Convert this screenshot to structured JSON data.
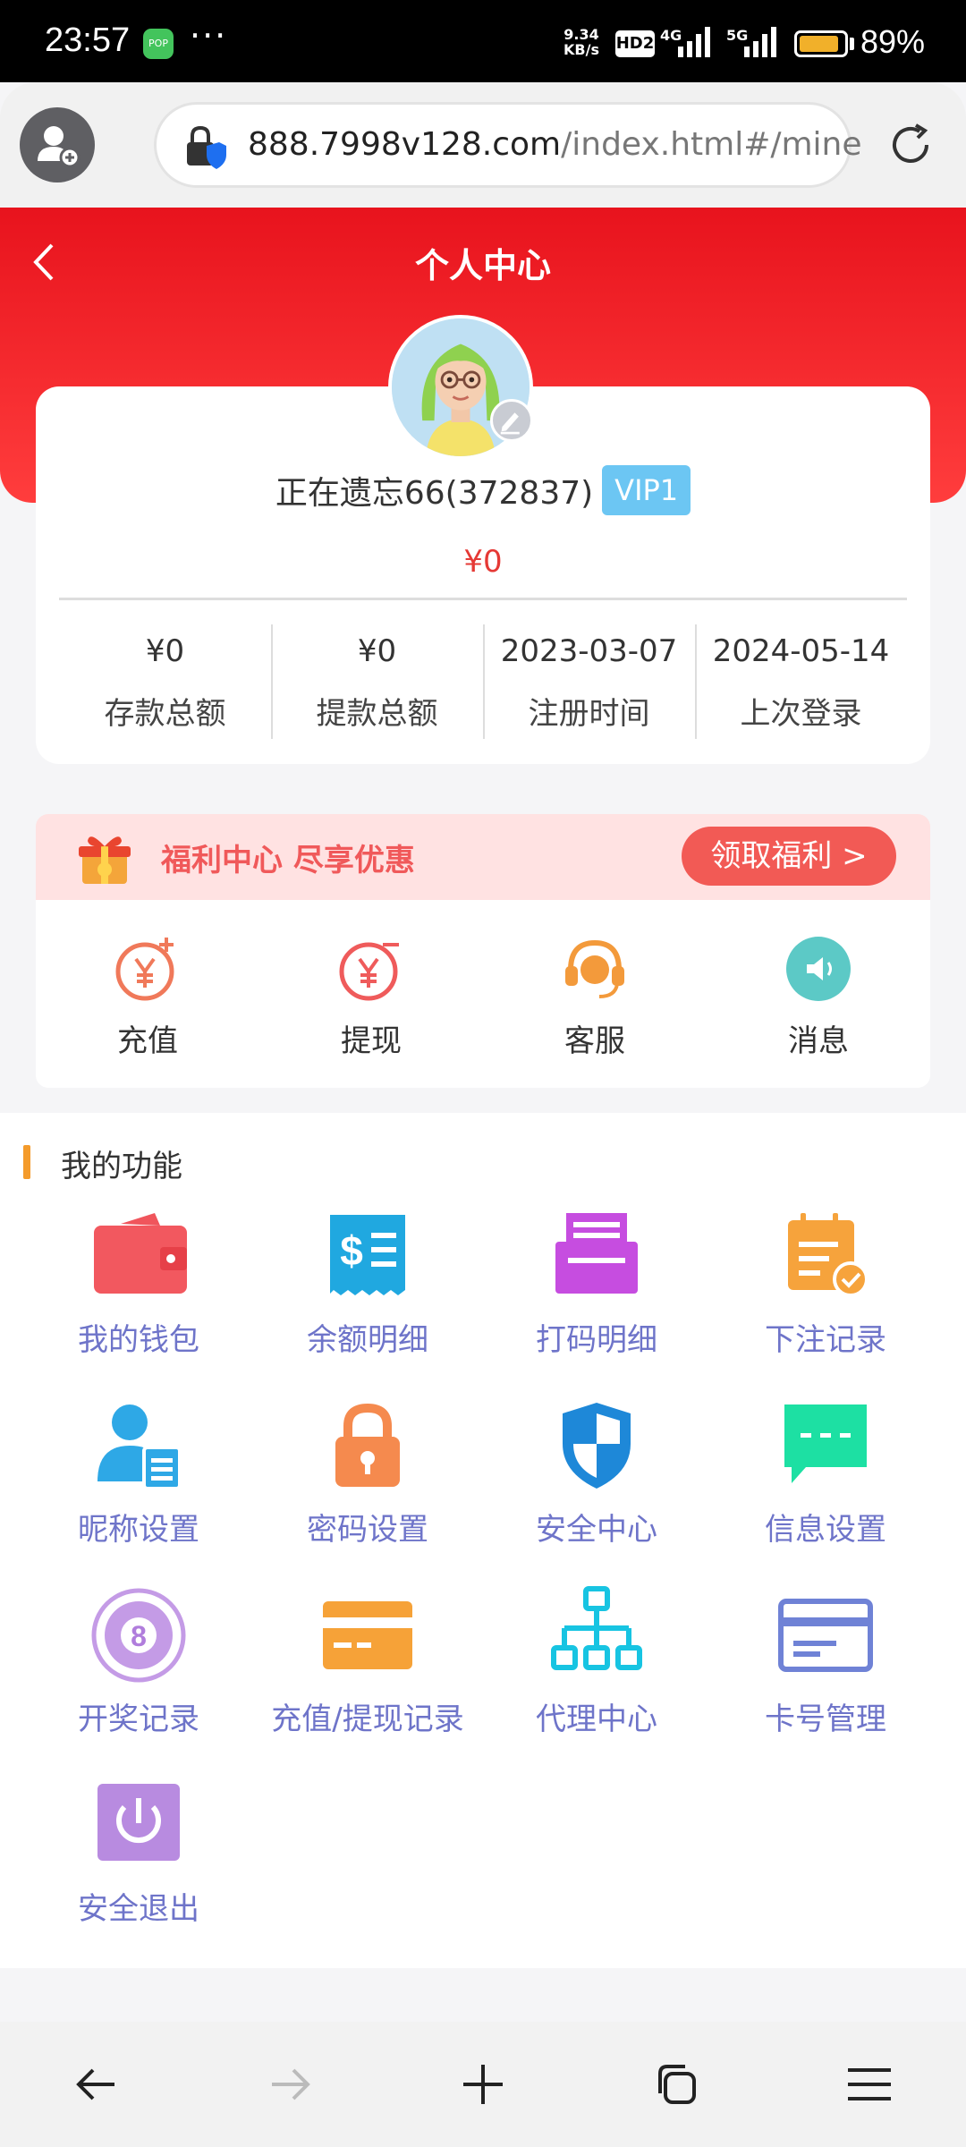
{
  "status_bar": {
    "time": "23:57",
    "app_badge": "POP",
    "more": "···",
    "net_speed_value": "9.34",
    "net_speed_unit": "KB/s",
    "hd_label": "HD2",
    "net1": "4G",
    "net2": "5G",
    "battery_percent": 89,
    "battery_text": "89%"
  },
  "browser": {
    "url_host": "888.7998v128.com",
    "url_path": "/index.html#/mine"
  },
  "header": {
    "title": "个人中心"
  },
  "profile": {
    "username": "正在遗忘66(372837)",
    "vip": "VIP1",
    "balance": "¥0"
  },
  "stats": [
    {
      "value": "¥0",
      "label": "存款总额"
    },
    {
      "value": "¥0",
      "label": "提款总额"
    },
    {
      "value": "2023-03-07",
      "label": "注册时间"
    },
    {
      "value": "2024-05-14",
      "label": "上次登录"
    }
  ],
  "welfare": {
    "text": "福利中心 尽享优惠",
    "button": "领取福利 >"
  },
  "quick_actions": [
    {
      "label": "充值",
      "icon": "recharge-icon"
    },
    {
      "label": "提现",
      "icon": "withdraw-icon"
    },
    {
      "label": "客服",
      "icon": "customer-service-icon"
    },
    {
      "label": "消息",
      "icon": "message-icon"
    }
  ],
  "functions": {
    "title": "我的功能",
    "items": [
      {
        "label": "我的钱包",
        "icon": "wallet-icon"
      },
      {
        "label": "余额明细",
        "icon": "receipt-icon"
      },
      {
        "label": "打码明细",
        "icon": "printer-icon"
      },
      {
        "label": "下注记录",
        "icon": "clipboard-check-icon"
      },
      {
        "label": "昵称设置",
        "icon": "user-card-icon"
      },
      {
        "label": "密码设置",
        "icon": "lock-icon"
      },
      {
        "label": "安全中心",
        "icon": "shield-icon"
      },
      {
        "label": "信息设置",
        "icon": "chat-bubble-icon"
      },
      {
        "label": "开奖记录",
        "icon": "lottery-ball-icon"
      },
      {
        "label": "充值/提现记录",
        "icon": "card-icon"
      },
      {
        "label": "代理中心",
        "icon": "hierarchy-icon"
      },
      {
        "label": "卡号管理",
        "icon": "bank-card-icon"
      },
      {
        "label": "安全退出",
        "icon": "power-icon"
      }
    ]
  },
  "colors": {
    "header_red": "#e8131d",
    "accent_orange": "#f49b2b",
    "function_label": "#6e74c9",
    "vip_blue": "#6cc6f3",
    "welfare_button": "#f25a55"
  }
}
